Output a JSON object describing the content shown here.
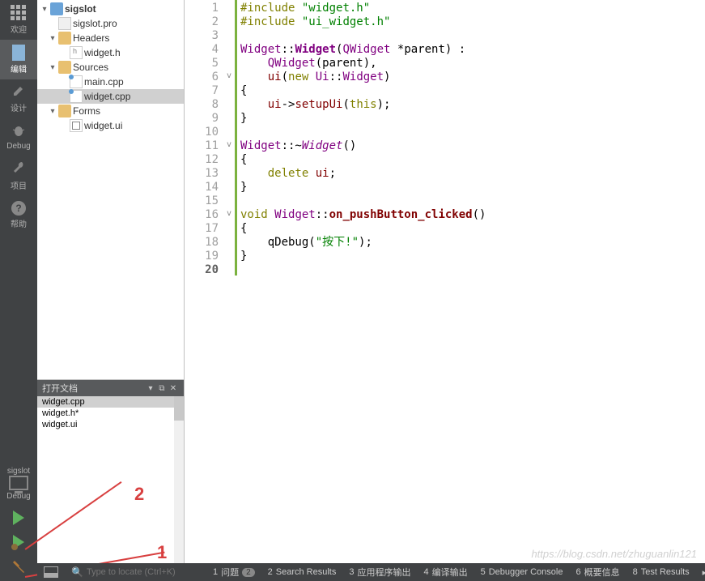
{
  "leftbar": {
    "items": [
      {
        "label": "欢迎",
        "icon": "grid"
      },
      {
        "label": "编辑",
        "icon": "page",
        "active": true
      },
      {
        "label": "设计",
        "icon": "pencil"
      },
      {
        "label": "Debug",
        "icon": "bug"
      },
      {
        "label": "项目",
        "icon": "wrench"
      },
      {
        "label": "帮助",
        "icon": "help"
      }
    ],
    "project_label": "sigslot",
    "config_label": "Debug"
  },
  "tree": {
    "root": {
      "label": "sigslot",
      "expanded": true
    },
    "pro": {
      "label": "sigslot.pro"
    },
    "headers": {
      "label": "Headers",
      "expanded": true
    },
    "widget_h": {
      "label": "widget.h"
    },
    "sources": {
      "label": "Sources",
      "expanded": true
    },
    "main_cpp": {
      "label": "main.cpp"
    },
    "widget_cpp": {
      "label": "widget.cpp",
      "selected": true
    },
    "forms": {
      "label": "Forms",
      "expanded": true
    },
    "widget_ui": {
      "label": "widget.ui"
    }
  },
  "open_docs": {
    "title": "打开文档",
    "items": [
      {
        "label": "widget.cpp",
        "selected": true
      },
      {
        "label": "widget.h*"
      },
      {
        "label": "widget.ui"
      }
    ]
  },
  "annotations": {
    "one": "1",
    "two": "2"
  },
  "code": {
    "lines_count": 20,
    "current_line": 20,
    "fold_markers": {
      "6": "v",
      "11": "v",
      "16": "v"
    },
    "green_ranges": [
      [
        1,
        20
      ]
    ],
    "lines": {
      "1": {
        "include": "#include",
        "str": "\"widget.h\""
      },
      "2": {
        "include": "#include",
        "str": "\"ui_widget.h\""
      },
      "3": {
        "plain": ""
      },
      "4": {
        "type": "Widget",
        "sep1": "::",
        "ctor": "Widget",
        "paren_open": "(",
        "argtype": "QWidget",
        "rest": " *parent) :"
      },
      "5": {
        "indent": "    ",
        "base": "QWidget",
        "rest": "(parent),"
      },
      "6": {
        "indent": "    ",
        "member": "ui",
        "paren_open": "(",
        "new": "new",
        "sp": " ",
        "ns": "Ui",
        "sep": "::",
        "cls": "Widget",
        "paren_close": ")"
      },
      "7": {
        "plain": "{"
      },
      "8": {
        "indent": "    ",
        "member": "ui",
        "arrow": "->",
        "method": "setupUi",
        "paren_open": "(",
        "this": "this",
        "rest": ");"
      },
      "9": {
        "plain": "}"
      },
      "10": {
        "plain": ""
      },
      "11": {
        "type": "Widget",
        "sep1": "::~",
        "dtor": "Widget",
        "rest": "()"
      },
      "12": {
        "plain": "{"
      },
      "13": {
        "indent": "    ",
        "delete": "delete",
        "sp": " ",
        "member": "ui",
        "semi": ";"
      },
      "14": {
        "plain": "}"
      },
      "15": {
        "plain": ""
      },
      "16": {
        "void": "void",
        "sp": " ",
        "type": "Widget",
        "sep": "::",
        "slot": "on_pushButton_clicked",
        "rest": "()"
      },
      "17": {
        "plain": "{"
      },
      "18": {
        "indent": "    ",
        "call": "qDebug",
        "paren_open": "(",
        "str": "\"按下!\"",
        "rest": ");"
      },
      "19": {
        "plain": "}"
      },
      "20": {
        "plain": ""
      }
    }
  },
  "statusbar": {
    "locate_placeholder": "Type to locate (Ctrl+K)",
    "panes": [
      {
        "num": "1",
        "label": "问题",
        "badge": "2"
      },
      {
        "num": "2",
        "label": "Search Results"
      },
      {
        "num": "3",
        "label": "应用程序输出"
      },
      {
        "num": "4",
        "label": "编译输出"
      },
      {
        "num": "5",
        "label": "Debugger Console"
      },
      {
        "num": "6",
        "label": "概要信息"
      },
      {
        "num": "8",
        "label": "Test Results"
      }
    ]
  },
  "watermark": "https://blog.csdn.net/zhuguanlin121"
}
